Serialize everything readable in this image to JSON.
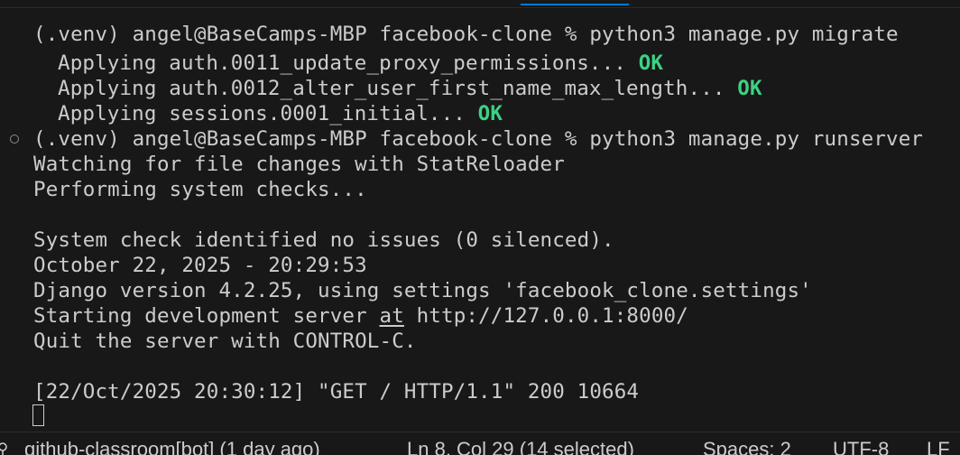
{
  "terminal": {
    "lines": [
      {
        "prefix": "(.venv) angel@BaseCamps-MBP facebook-clone % ",
        "cmd": "python3 manage.py migrate"
      },
      {
        "text": "Applying auth.0011_update_proxy_permissions... ",
        "ok": "OK"
      },
      {
        "text": "Applying auth.0012_alter_user_first_name_max_length... ",
        "ok": "OK"
      },
      {
        "text": "Applying sessions.0001_initial... ",
        "ok": "OK"
      },
      {
        "prefix": "(.venv) angel@BaseCamps-MBP facebook-clone % ",
        "cmd": "python3 manage.py runserver"
      },
      {
        "text": "Watching for file changes with StatReloader"
      },
      {
        "text": "Performing system checks..."
      },
      {
        "text": "System check identified no issues (0 silenced)."
      },
      {
        "text": "October 22, 2025 - 20:29:53"
      },
      {
        "text": "Django version 4.2.25, using settings 'facebook_clone.settings'"
      },
      {
        "text_before": "Starting development server ",
        "text_link": "at",
        "text_after": " http://127.0.0.1:8000/"
      },
      {
        "text": "Quit the server with CONTROL-C."
      },
      {
        "text": "[22/Oct/2025 20:30:12] \"GET / HTTP/1.1\" 200 10664"
      }
    ],
    "ok_color": "#3cd183"
  },
  "status_bar": {
    "git_blame": "github-classroom[bot] (1 day ago)",
    "cursor_position": "Ln 8, Col 29 (14 selected)",
    "spaces": "Spaces: 2",
    "encoding": "UTF-8",
    "eol": "LF"
  }
}
